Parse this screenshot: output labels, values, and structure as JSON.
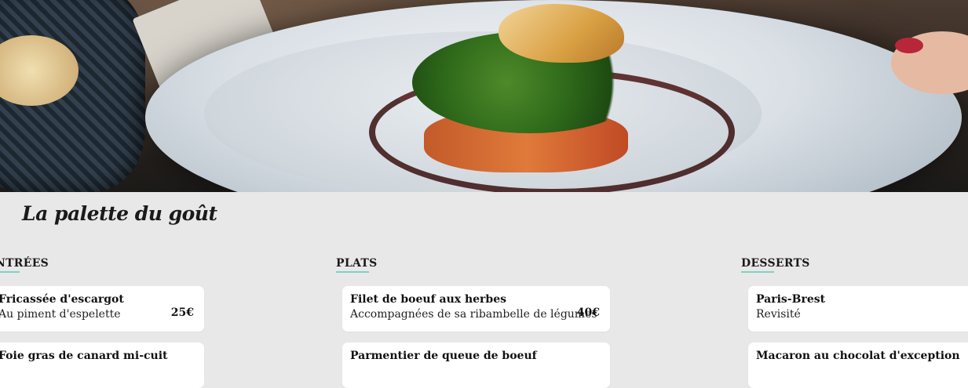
{
  "hero": {
    "image": "restaurant-dish-photo"
  },
  "site_title": "La palette du goût",
  "sections": [
    {
      "heading": "ENTRÉES",
      "items": [
        {
          "name": "Fricassée d'escargot",
          "description": "Au piment d'espelette",
          "price": "25€"
        },
        {
          "name": "Foie gras de canard mi-cuit",
          "description": "",
          "price": ""
        }
      ]
    },
    {
      "heading": "PLATS",
      "items": [
        {
          "name": "Filet de boeuf aux herbes",
          "description": "Accompagnées de sa ribambelle de légumes",
          "price": "40€"
        },
        {
          "name": "Parmentier de queue de boeuf",
          "description": "",
          "price": ""
        }
      ]
    },
    {
      "heading": "DESSERTS",
      "items": [
        {
          "name": "Paris-Brest",
          "description": "Revisité",
          "price": ""
        },
        {
          "name": "Macaron au chocolat d'exception",
          "description": "",
          "price": ""
        }
      ]
    }
  ]
}
